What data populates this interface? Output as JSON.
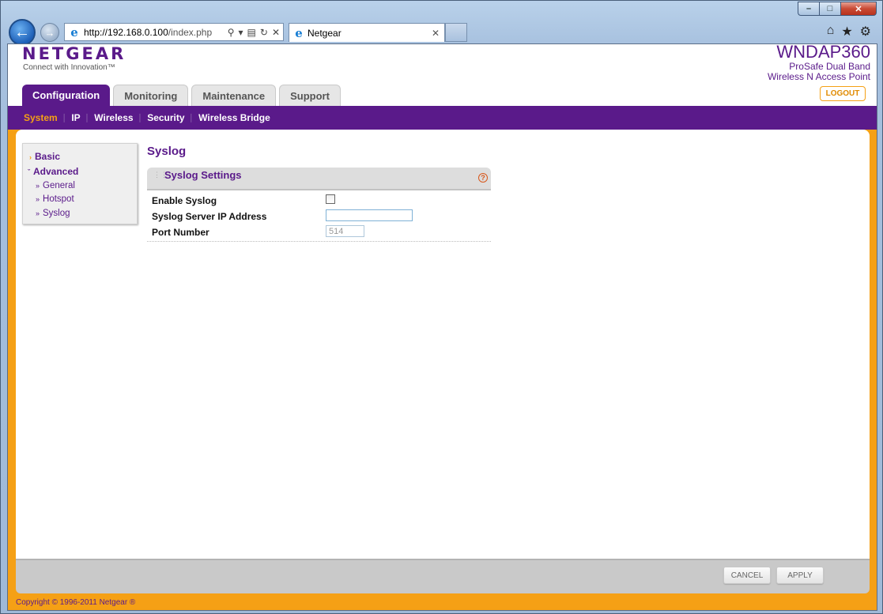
{
  "browser": {
    "url_host": "http://192.168.0.100",
    "url_path": "/index.php",
    "tab_title": "Netgear"
  },
  "brand": {
    "logo": "NETGEAR",
    "tagline": "Connect with Innovation™",
    "model": "WNDAP360",
    "desc1": "ProSafe Dual Band",
    "desc2": "Wireless N Access Point",
    "logout": "LOGOUT"
  },
  "tabs": [
    "Configuration",
    "Monitoring",
    "Maintenance",
    "Support"
  ],
  "subnav": [
    "System",
    "IP",
    "Wireless",
    "Security",
    "Wireless Bridge"
  ],
  "sidebar": {
    "basic": "Basic",
    "advanced": "Advanced",
    "items": [
      "General",
      "Hotspot",
      "Syslog"
    ]
  },
  "page": {
    "title": "Syslog",
    "section": "Syslog Settings",
    "fields": {
      "enable": "Enable Syslog",
      "server_ip": "Syslog Server IP Address",
      "port": "Port Number",
      "port_value": "514"
    }
  },
  "buttons": {
    "cancel": "CANCEL",
    "apply": "APPLY"
  },
  "copyright": "Copyright © 1996-2011 Netgear ®",
  "colors": {
    "brand_purple": "#5a1a8a",
    "accent_orange": "#f5a015"
  }
}
